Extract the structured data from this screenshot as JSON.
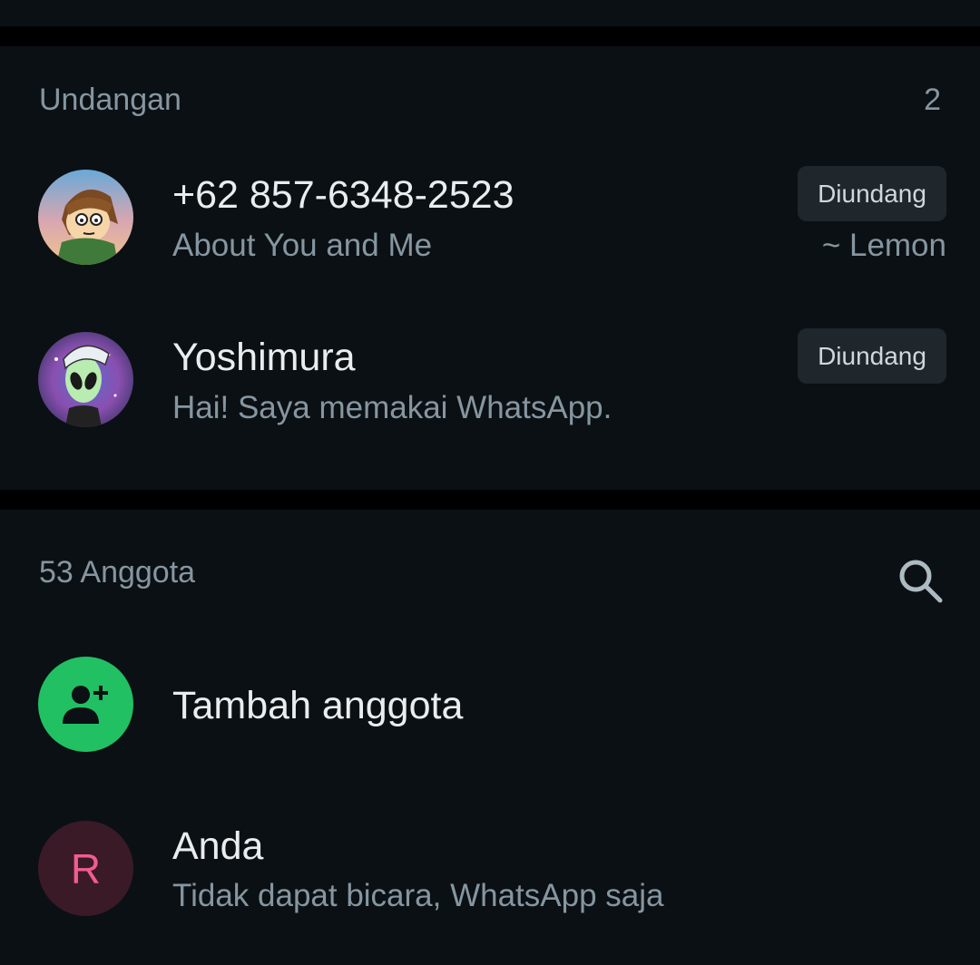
{
  "invites": {
    "title": "Undangan",
    "count": "2",
    "items": [
      {
        "name": "+62 857-6348-2523",
        "status": "About You and Me",
        "badge": "Diundang",
        "meta": "~ Lemon"
      },
      {
        "name": "Yoshimura",
        "status": "Hai! Saya memakai WhatsApp.",
        "badge": "Diundang"
      }
    ]
  },
  "members": {
    "title": "53 Anggota",
    "search_icon": "search-icon",
    "add_label": "Tambah anggota",
    "add_icon": "add-person-icon",
    "items": [
      {
        "initial": "R",
        "name": "Anda",
        "status": "Tidak dapat bicara, WhatsApp saja"
      }
    ]
  },
  "colors": {
    "background": "#0b1014",
    "accent_green": "#21c063",
    "secondary_text": "#8696a0",
    "badge_bg": "#1f272c",
    "avatar_letter": "#f15c8f"
  }
}
